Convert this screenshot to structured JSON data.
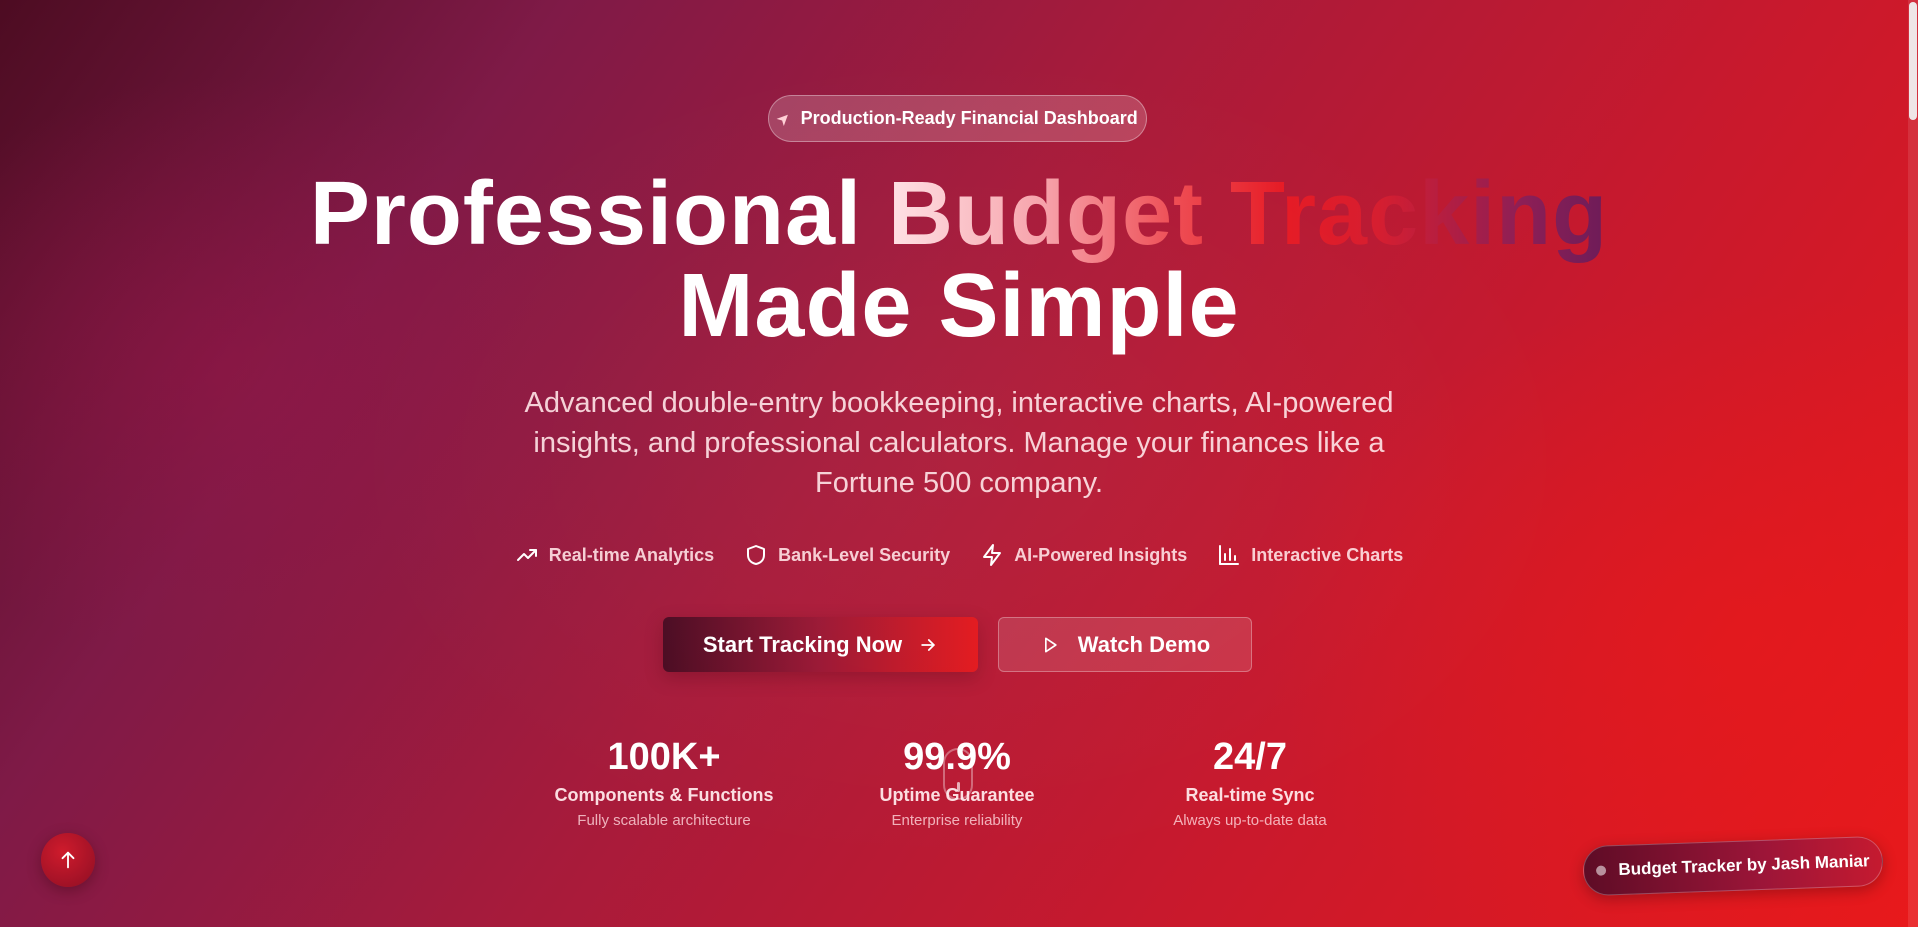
{
  "badge": {
    "icon": "rocket-icon",
    "text": "Production-Ready Financial Dashboard"
  },
  "hero": {
    "title_part1": "Professional ",
    "title_highlight": "Budget Tracking",
    "title_line2": "Made Simple",
    "subtitle": "Advanced double-entry bookkeeping, interactive charts, AI-powered insights, and professional calculators. Manage your finances like a Fortune 500 company."
  },
  "features": [
    {
      "icon": "trending-up-icon",
      "label": "Real-time Analytics"
    },
    {
      "icon": "shield-icon",
      "label": "Bank-Level Security"
    },
    {
      "icon": "lightning-icon",
      "label": "AI-Powered Insights"
    },
    {
      "icon": "bar-chart-icon",
      "label": "Interactive Charts"
    }
  ],
  "cta": {
    "primary_label": "Start Tracking Now",
    "primary_icon": "arrow-right-icon",
    "secondary_label": "Watch Demo",
    "secondary_icon": "play-icon"
  },
  "stats": [
    {
      "value": "100K+",
      "label": "Components & Functions",
      "desc": "Fully scalable architecture"
    },
    {
      "value": "99.9%",
      "label": "Uptime Guarantee",
      "desc": "Enterprise reliability"
    },
    {
      "value": "24/7",
      "label": "Real-time Sync",
      "desc": "Always up-to-date data"
    }
  ],
  "back_to_top": {
    "icon": "arrow-up-icon"
  },
  "credit": {
    "text": "Budget Tracker by Jash Maniar"
  },
  "colors": {
    "gradient_start": "#4d0c22",
    "gradient_mid": "#a71b3b",
    "gradient_end": "#e8191b",
    "accent_red": "#e3181d"
  }
}
